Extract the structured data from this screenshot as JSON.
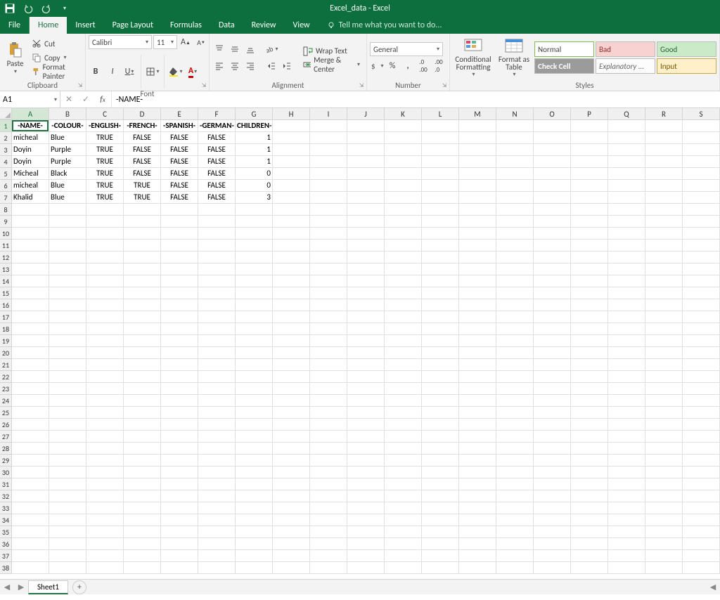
{
  "app_title": "Excel_data - Excel",
  "qat": {
    "save": "Save",
    "undo": "Undo",
    "redo": "Redo"
  },
  "tabs": {
    "file": "File",
    "home": "Home",
    "insert": "Insert",
    "page_layout": "Page Layout",
    "formulas": "Formulas",
    "data": "Data",
    "review": "Review",
    "view": "View",
    "tell_me": "Tell me what you want to do..."
  },
  "ribbon": {
    "clipboard": {
      "label": "Clipboard",
      "paste": "Paste",
      "cut": "Cut",
      "copy": "Copy",
      "format_painter": "Format Painter"
    },
    "font": {
      "label": "Font",
      "name": "Calibri",
      "size": "11",
      "bold": "B",
      "italic": "I",
      "underline": "U"
    },
    "alignment": {
      "label": "Alignment",
      "wrap_text": "Wrap Text",
      "merge_center": "Merge & Center"
    },
    "number": {
      "label": "Number",
      "format": "General",
      "percent": "%",
      "comma": ","
    },
    "styles": {
      "label": "Styles",
      "conditional_formatting": "Conditional Formatting",
      "format_as_table": "Format as Table",
      "cells": {
        "normal": "Normal",
        "bad": "Bad",
        "good": "Good",
        "check": "Check Cell",
        "explanatory": "Explanatory ...",
        "input": "Input"
      }
    }
  },
  "name_box": "A1",
  "formula_bar": "-NAME-",
  "columns": [
    "A",
    "B",
    "C",
    "D",
    "E",
    "F",
    "G",
    "H",
    "I",
    "J",
    "K",
    "L",
    "M",
    "N",
    "O",
    "P",
    "Q",
    "R",
    "S"
  ],
  "grid": {
    "headers": [
      "-NAME-",
      "-COLOUR-",
      "-ENGLISH-",
      "-FRENCH-",
      "-SPANISH-",
      "-GERMAN-",
      "CHILDREN-"
    ],
    "rows": [
      {
        "name": "micheal",
        "colour": "Blue",
        "english": "TRUE",
        "french": "FALSE",
        "spanish": "FALSE",
        "german": "FALSE",
        "children": 1
      },
      {
        "name": "Doyin",
        "colour": "Purple",
        "english": "TRUE",
        "french": "FALSE",
        "spanish": "FALSE",
        "german": "FALSE",
        "children": 1
      },
      {
        "name": "Doyin",
        "colour": "Purple",
        "english": "TRUE",
        "french": "FALSE",
        "spanish": "FALSE",
        "german": "FALSE",
        "children": 1
      },
      {
        "name": "Micheal",
        "colour": "Black",
        "english": "TRUE",
        "french": "FALSE",
        "spanish": "FALSE",
        "german": "FALSE",
        "children": 0
      },
      {
        "name": "micheal",
        "colour": "Blue",
        "english": "TRUE",
        "french": "TRUE",
        "spanish": "FALSE",
        "german": "FALSE",
        "children": 0
      },
      {
        "name": "Khalid",
        "colour": "Blue",
        "english": "TRUE",
        "french": "TRUE",
        "spanish": "FALSE",
        "german": "FALSE",
        "children": 3
      }
    ],
    "total_visible_rows": 38
  },
  "sheet_tabs": {
    "active": "Sheet1"
  },
  "colors": {
    "brand": "#0d6e3e",
    "accent": "#217346",
    "ribbon_bg": "#f3f3f3",
    "gridline": "#e0e0e0"
  }
}
